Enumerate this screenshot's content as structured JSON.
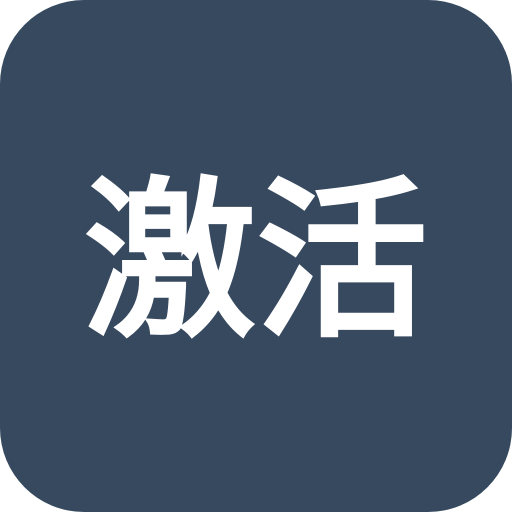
{
  "app_icon": {
    "label": "激活",
    "background_color": "#37495f",
    "text_color": "#ffffff"
  }
}
